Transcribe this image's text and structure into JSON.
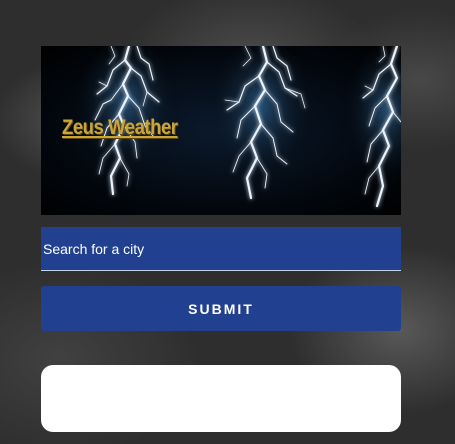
{
  "header": {
    "title": "Zeus Weather"
  },
  "search": {
    "placeholder": "Search for a city",
    "value": ""
  },
  "submit": {
    "label": "SUBMIT"
  },
  "results": {
    "content": ""
  },
  "colors": {
    "primary": "#21408f",
    "title_gold": "#c9a53c",
    "card_bg": "#ffffff"
  },
  "icons": {
    "banner_art": "lightning-bolts"
  }
}
